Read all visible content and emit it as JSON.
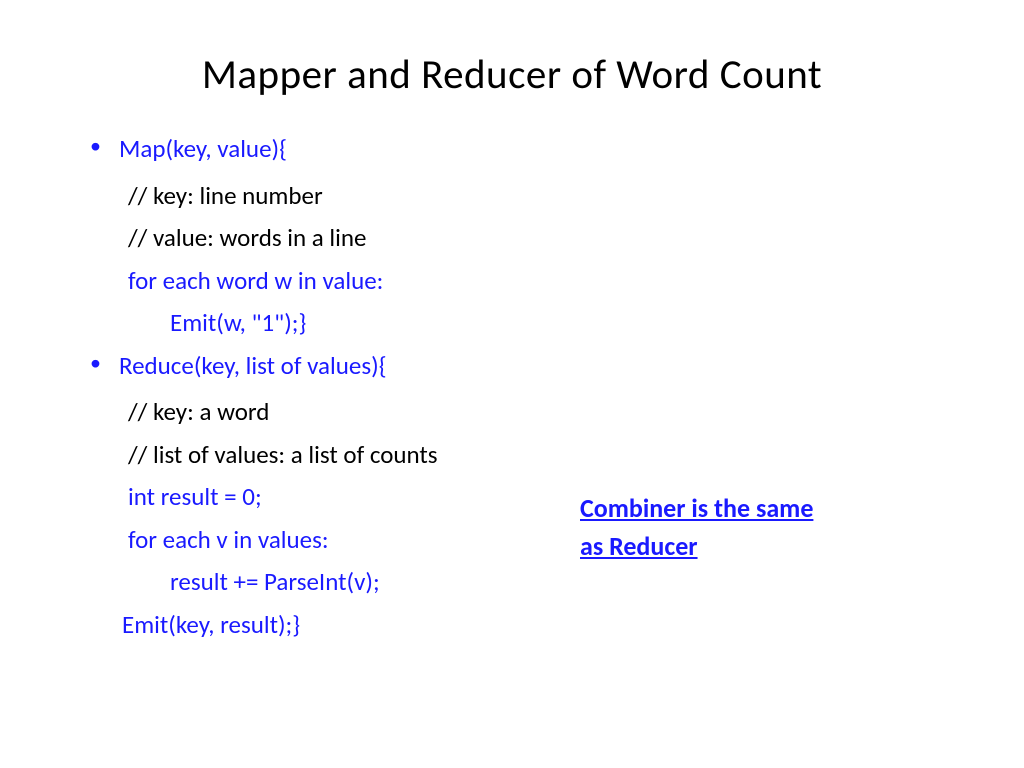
{
  "title": "Mapper and Reducer of Word Count",
  "map": {
    "header": "Map(key, value){",
    "comment1": "// key: line number",
    "comment2": "// value: words in a line",
    "loop": "for each word w in value:",
    "emit": "Emit(w, \"1\");}"
  },
  "reduce": {
    "header": "Reduce(key, list of values){",
    "comment1": "// key: a word",
    "comment2": "// list of values: a list of counts",
    "init": "int result = 0;",
    "loop": "for each v in values:",
    "body": "result += ParseInt(v);",
    "emit": "Emit(key, result);}"
  },
  "note_line1": "Combiner is the same",
  "note_line2": "as Reducer"
}
